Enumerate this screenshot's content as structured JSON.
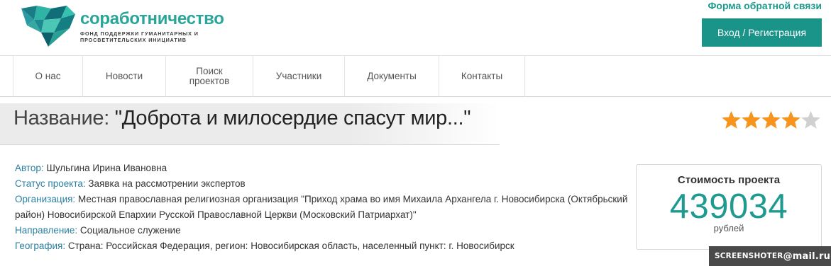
{
  "header": {
    "logo_title": "соработничество",
    "logo_subtitle_line1": "ФОНД ПОДДЕРЖКИ ГУМАНИТАРНЫХ И",
    "logo_subtitle_line2": "ПРОСВЕТИТЕЛЬСКИХ ИНИЦИАТИВ",
    "feedback_link": "Форма обратной связи",
    "login_button": "Вход / Регистрация"
  },
  "nav": {
    "items": [
      {
        "label": "О нас"
      },
      {
        "label": "Новости"
      },
      {
        "label_line1": "Поиск",
        "label_line2": "проектов"
      },
      {
        "label": "Участники"
      },
      {
        "label": "Документы"
      },
      {
        "label": "Контакты"
      }
    ]
  },
  "project": {
    "title_label": "Название:",
    "title_value": "\"Доброта и милосердие спасут мир...\"",
    "rating": 4,
    "rating_max": 5,
    "details": [
      {
        "label": "Автор:",
        "value": "Шульгина Ирина Ивановна"
      },
      {
        "label": "Статус проекта:",
        "value": "Заявка на рассмотрении экспертов"
      },
      {
        "label": "Организация:",
        "value": "Местная православная религиозная организация \"Приход храма во имя Михаила Архангела г. Новосибирска (Октябрьский район) Новосибирской Епархии Русской Православной Церкви (Московский Патриархат)\""
      },
      {
        "label": "Направление:",
        "value": "Социальное служение"
      },
      {
        "label": "География:",
        "value": "Страна: Российская Федерация, регион: Новосибирская область, населенный пункт: г. Новосибирск"
      }
    ],
    "cost": {
      "title": "Стоимость проекта",
      "value": "439034",
      "unit": "рублей"
    }
  },
  "watermark": {
    "text_left": "SCREENSHOTER",
    "text_right": "@mail.ru"
  },
  "colors": {
    "brand_teal": "#1a9389",
    "label_blue": "#2b7fa0",
    "star_orange": "#f7941d",
    "star_empty": "#d0d0d0"
  }
}
